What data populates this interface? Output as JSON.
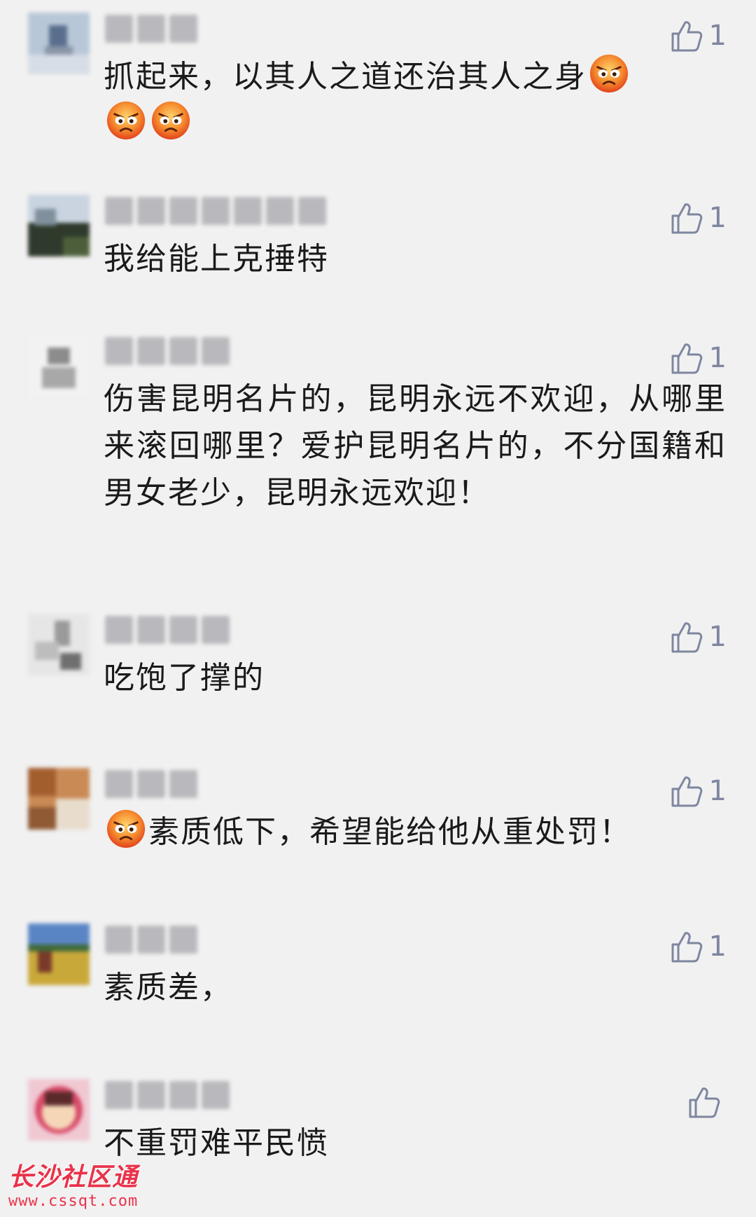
{
  "comments": [
    {
      "text": "抓起来，以其人之道还治其人之身",
      "trailing_emojis": [
        "angry-face",
        "angry-face",
        "angry-face"
      ],
      "likes": "1"
    },
    {
      "text": "我给能上克捶特",
      "likes": "1"
    },
    {
      "text": "伤害昆明名片的，昆明永远不欢迎，从哪里来滚回哪里？爱护昆明名片的，不分国籍和男女老少，昆明永远欢迎！",
      "likes": "1"
    },
    {
      "text": "吃饱了撑的",
      "likes": "1"
    },
    {
      "leading_emoji": "angry-face",
      "text": "素质低下，希望能给他从重处罚！",
      "likes": "1"
    },
    {
      "text": "素质差，",
      "likes": "1"
    },
    {
      "text": "不重罚难平民愤",
      "likes": ""
    }
  ],
  "watermark": {
    "logo": "长沙社区通",
    "url": "www.cssqt.com"
  },
  "colors": {
    "background": "#f1f1f1",
    "text": "#1a1a1a",
    "like_icon": "#7e86a0",
    "watermark": "#e8334a"
  }
}
